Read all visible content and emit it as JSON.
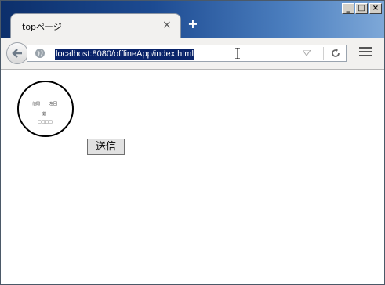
{
  "browser": {
    "tab": {
      "title": "topページ",
      "close_glyph": "×"
    },
    "new_tab_glyph": "+",
    "url": "localhost:8080/offlineApp/index.html",
    "window_controls": {
      "minimize": "_",
      "maximize": "□",
      "close": "×"
    }
  },
  "page": {
    "circle_labels": [
      "他問",
      "左回",
      "錨",
      "□□□□"
    ],
    "send_button_label": "送信"
  },
  "colors": {
    "title_gradient_start": "#0c2f6b",
    "title_gradient_end": "#7ea8d8",
    "url_selection": "#0a246a"
  },
  "icons": [
    "back-arrow-icon",
    "globe-icon",
    "text-cursor-icon",
    "dropdown-arrow-icon",
    "reload-icon",
    "hamburger-menu-icon",
    "close-icon",
    "plus-icon"
  ]
}
